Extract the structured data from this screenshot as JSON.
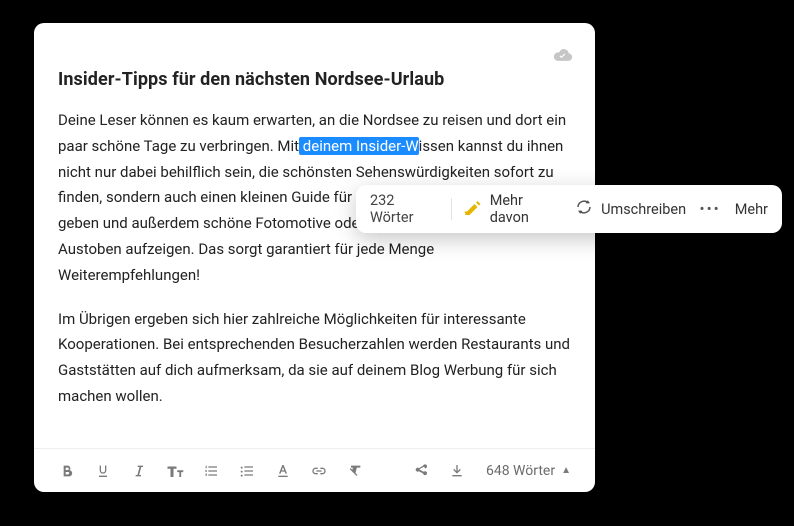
{
  "doc": {
    "title": "Insider-Tipps für den nächsten Nordsee-Urlaub",
    "para1_a": "Deine Leser können es kaum erwarten, an die Nordsee zu reisen und dort ein paar schöne Tage zu verbringen. Mit",
    "para1_hl": " deinem Insider-W",
    "para1_b": "issen kannst du ihnen nicht nur dabei behilflich sein, die schönsten Sehenswürdigkeiten sofort zu finden, sondern auch einen kleinen Guide für günstige und tolle Unterkünfte geben und außerdem schöne Fotomotive oder Gegenden zum fotografischen Austoben aufzeigen. Das sorgt garantiert für jede Menge Weiterempfehlungen!",
    "para2": "Im Übrigen ergeben sich hier zahlreiche Möglichkeiten für interessante Kooperationen. Bei entsprechenden Besucherzahlen werden Restaurants und Gaststätten auf dich aufmerksam, da sie auf deinem Blog Werbung für sich machen wollen."
  },
  "toolbar": {
    "total_words": "648 Wörter"
  },
  "suggest": {
    "count": "232 Wörter",
    "more_of_this": "Mehr davon",
    "rewrite": "Umschreiben",
    "more": "Mehr"
  }
}
